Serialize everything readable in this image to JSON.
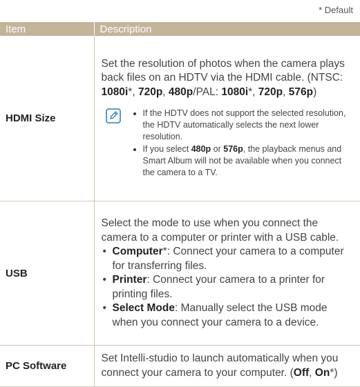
{
  "default_note": "* Default",
  "header": {
    "item": "Item",
    "description": "Description"
  },
  "hdmi": {
    "label": "HDMI Size",
    "p1": "Set the resolution of photos when the camera plays back files on an HDTV via the HDMI cable. (NTSC: ",
    "v1": "1080i",
    "s1": "*, ",
    "v2": "720p",
    "s2": ", ",
    "v3": "480p",
    "s3": "/PAL: ",
    "v4": "1080i",
    "s4": "*, ",
    "v5": "720p",
    "s5": ", ",
    "v6": "576p",
    "s6": ")",
    "note1": "If the HDTV does not support the selected resolution, the HDTV automatically selects the next lower resolution.",
    "note2_a": "If you select ",
    "note2_b": "480p",
    "note2_c": " or ",
    "note2_d": "576p",
    "note2_e": ", the playback menus and Smart Album will not be available when you connect the camera to a TV.",
    "note_icon": "note-pencil-icon"
  },
  "usb": {
    "label": "USB",
    "intro": "Select the mode to use when you connect the camera to a computer or printer with a USB cable.",
    "items": [
      {
        "term": "Computer",
        "mark": "*",
        "text": ": Connect your camera to a computer for transferring files."
      },
      {
        "term": "Printer",
        "mark": "",
        "text": ": Connect your camera to a printer for printing files."
      },
      {
        "term": "Select Mode",
        "mark": "",
        "text": ": Manually select the USB mode when you connect your camera to a device."
      }
    ]
  },
  "pc": {
    "label": "PC Software",
    "text": "Set Intelli-studio to launch automatically when you connect your camera to your computer. (",
    "opt1": "Off",
    "sep": ", ",
    "opt2": "On",
    "end": "*)"
  },
  "colors": {
    "header_bg": "#c3b49a",
    "rule": "#d4c7b3",
    "icon": "#2a7fc1"
  }
}
